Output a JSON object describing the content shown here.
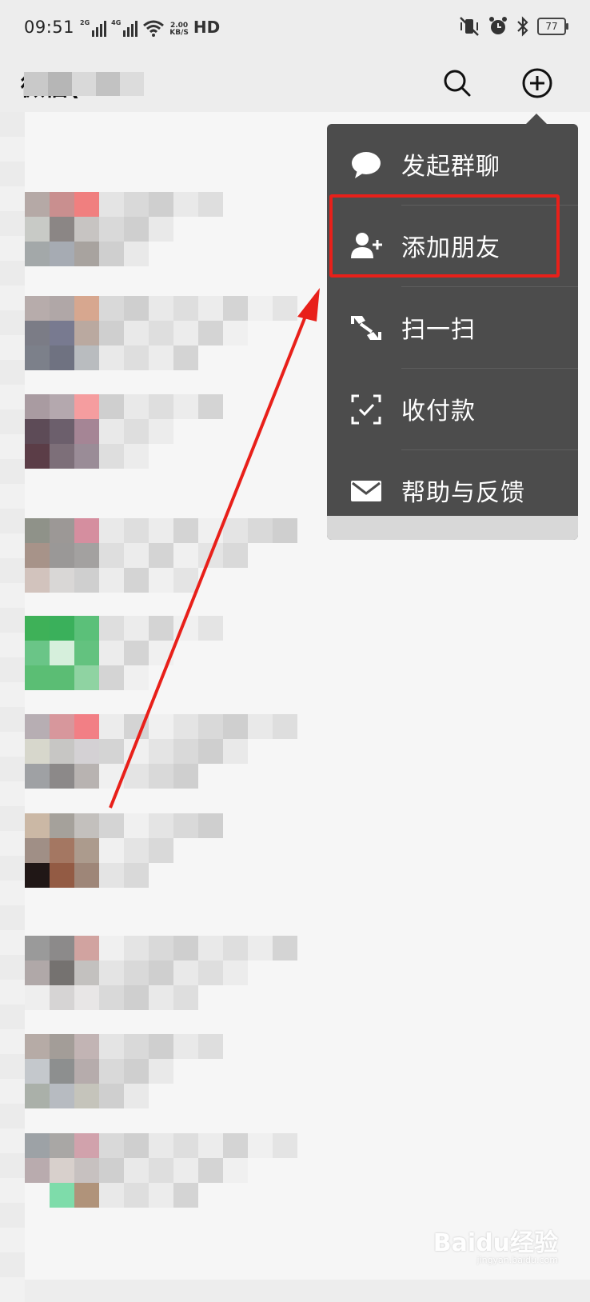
{
  "status_bar": {
    "time": "09:51",
    "signal1_tag": "2G",
    "signal2_tag": "4G",
    "net_speed_value": "2.00",
    "net_speed_unit": "KB/S",
    "hd_label": "HD",
    "battery": "77"
  },
  "header": {
    "title": "微信(1…",
    "search_icon": "search-icon",
    "add_icon": "plus-circle-icon"
  },
  "menu": {
    "items": [
      {
        "label": "发起群聊",
        "icon": "chat-bubble-icon"
      },
      {
        "label": "添加朋友",
        "icon": "add-friend-icon",
        "highlighted": true
      },
      {
        "label": "扫一扫",
        "icon": "scan-icon"
      },
      {
        "label": "收付款",
        "icon": "payment-scan-icon"
      },
      {
        "label": "帮助与反馈",
        "icon": "mail-icon"
      }
    ]
  },
  "annotation": {
    "highlight_color": "#e8201a",
    "arrow_color": "#e8201a"
  },
  "watermark": {
    "text": "Baidu经验",
    "sub": "jingyan.baidu.com"
  }
}
